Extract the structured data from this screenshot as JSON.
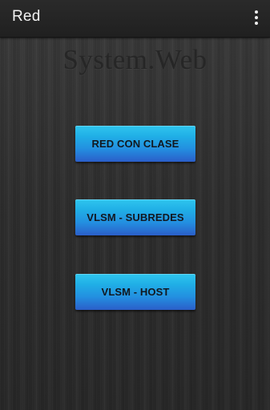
{
  "app_bar": {
    "title": "Red",
    "overflow_icon": "overflow-menu-icon"
  },
  "background": {
    "watermark": "System.Web"
  },
  "menu": {
    "buttons": [
      {
        "label": "RED CON CLASE"
      },
      {
        "label": "VLSM - SUBREDES"
      },
      {
        "label": "VLSM - HOST"
      }
    ]
  },
  "colors": {
    "action_bar": "#222222",
    "button_top": "#2fc6ee",
    "button_bottom": "#2b5ec9",
    "button_text": "#121820",
    "background": "#2e2e2e"
  }
}
